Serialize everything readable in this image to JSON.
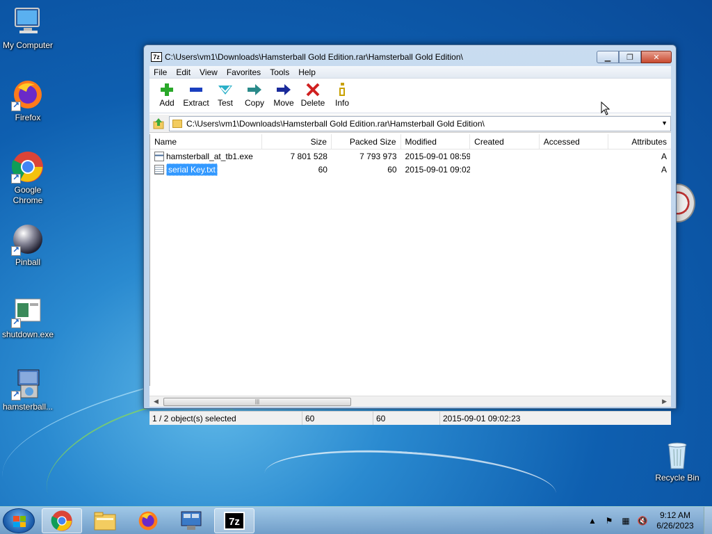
{
  "desktop": {
    "icons": [
      {
        "label": "My Computer"
      },
      {
        "label": "Firefox"
      },
      {
        "label": "Google Chrome"
      },
      {
        "label": "Pinball"
      },
      {
        "label": "shutdown.exe"
      },
      {
        "label": "hamsterball..."
      },
      {
        "label": "Recycle Bin"
      }
    ]
  },
  "window": {
    "title": "C:\\Users\\vm1\\Downloads\\Hamsterball Gold Edition.rar\\Hamsterball Gold Edition\\",
    "app_icon": "7z",
    "menu": [
      "File",
      "Edit",
      "View",
      "Favorites",
      "Tools",
      "Help"
    ],
    "toolbar": [
      {
        "label": "Add",
        "icon": "plus-icon",
        "color": "#2aa82a"
      },
      {
        "label": "Extract",
        "icon": "minus-icon",
        "color": "#1a3fbf"
      },
      {
        "label": "Test",
        "icon": "check-icon",
        "color": "#2ab0c8"
      },
      {
        "label": "Copy",
        "icon": "arrow-right-icon",
        "color": "#2a8a8a"
      },
      {
        "label": "Move",
        "icon": "arrow-right-icon",
        "color": "#1a2a9a"
      },
      {
        "label": "Delete",
        "icon": "x-icon",
        "color": "#d02020"
      },
      {
        "label": "Info",
        "icon": "info-icon",
        "color": "#c8a000"
      }
    ],
    "address": "C:\\Users\\vm1\\Downloads\\Hamsterball Gold Edition.rar\\Hamsterball Gold Edition\\",
    "columns": [
      "Name",
      "Size",
      "Packed Size",
      "Modified",
      "Created",
      "Accessed",
      "Attributes"
    ],
    "files": [
      {
        "name": "hamsterball_at_tb1.exe",
        "size": "7 801 528",
        "packed": "7 793 973",
        "modified": "2015-09-01 08:59",
        "attr": "A",
        "selected": false
      },
      {
        "name": "serial Key.txt",
        "size": "60",
        "packed": "60",
        "modified": "2015-09-01 09:02",
        "attr": "A",
        "selected": true
      }
    ],
    "status": {
      "selection": "1 / 2 object(s) selected",
      "size": "60",
      "packed": "60",
      "modified": "2015-09-01 09:02:23"
    }
  },
  "taskbar": {
    "clock_time": "9:12 AM",
    "clock_date": "6/26/2023",
    "active_app_label": "7z"
  }
}
